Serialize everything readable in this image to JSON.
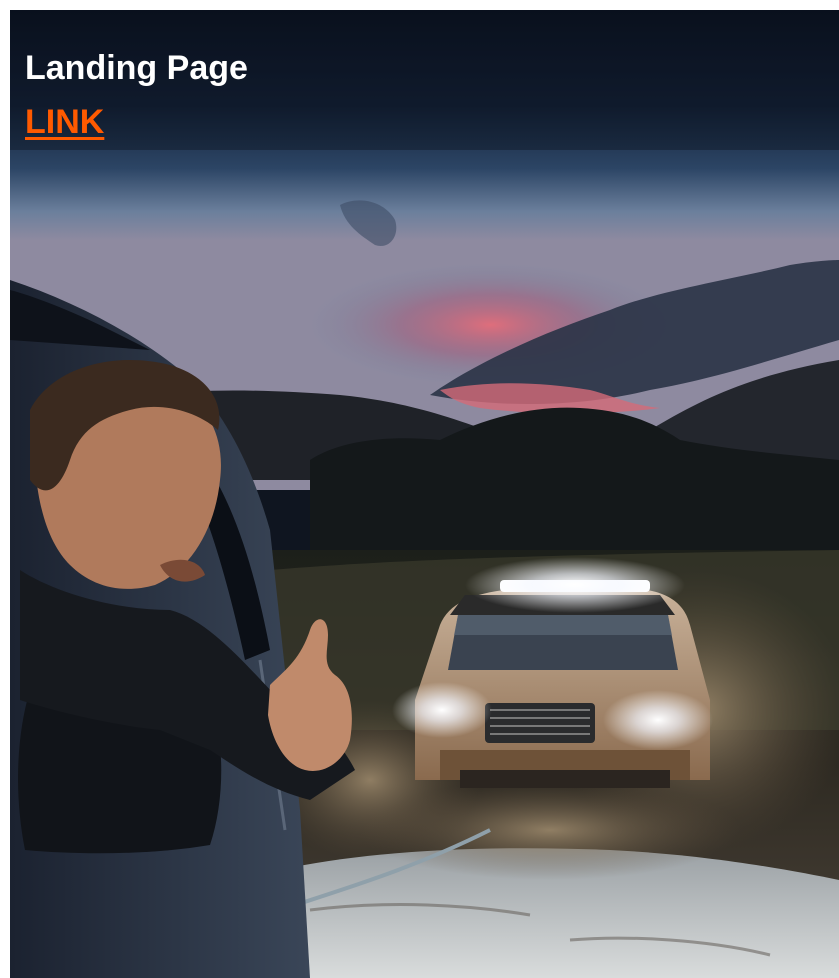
{
  "landing": {
    "title": "Landing Page",
    "link_label": "LINK"
  },
  "colors": {
    "title": "#ffffff",
    "link": "#ff5a00"
  },
  "hero_image": {
    "subject": "man leaning from window giving thumbs-up at off-road pickup splashing through mud at dusk"
  }
}
